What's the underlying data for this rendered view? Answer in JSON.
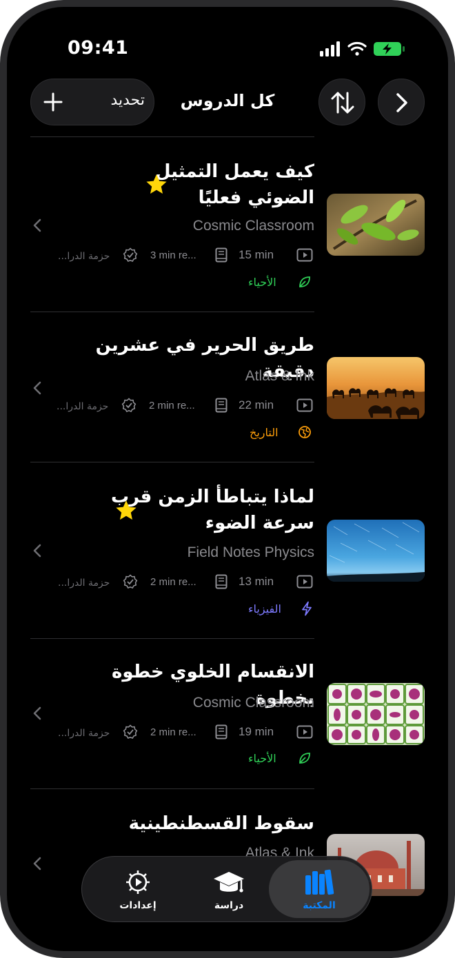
{
  "status_bar": {
    "time": "09:41"
  },
  "header": {
    "update_label": "تحديد",
    "title": "كل الدروس"
  },
  "lessons": [
    {
      "title_line1": "كيف يعمل التمثيل",
      "title_line2": "الضوئي فعليًا",
      "starred": true,
      "author": "Cosmic Classroom",
      "video_duration": "15 min",
      "reading_time": "3 min re...",
      "pack": "حزمة الدرا...",
      "subject": "الأحياء",
      "subject_color": "#30d158",
      "thumbnail": "leaves"
    },
    {
      "title_line1": "طريق الحرير في عشرين دقيقة",
      "starred": false,
      "author": "Atlas & Ink",
      "video_duration": "22 min",
      "reading_time": "2 min re...",
      "pack": "حزمة الدرا...",
      "subject": "التاريخ",
      "subject_color": "#ff9f0a",
      "thumbnail": "desert-camels"
    },
    {
      "title_line1": "لماذا يتباطأ الزمن قرب",
      "title_line2": "سرعة الضوء",
      "starred": true,
      "author": "Field Notes Physics",
      "video_duration": "13 min",
      "reading_time": "2 min re...",
      "pack": "حزمة الدرا...",
      "subject": "الفيزياء",
      "subject_color": "#7d7aff",
      "thumbnail": "star-trails"
    },
    {
      "title_line1": "الانقسام الخلوي خطوة بخطوة",
      "starred": false,
      "author": "Cosmic Classroom",
      "video_duration": "19 min",
      "reading_time": "2 min re...",
      "pack": "حزمة الدرا...",
      "subject": "الأحياء",
      "subject_color": "#30d158",
      "thumbnail": "cells"
    },
    {
      "title_line1": "سقوط القسطنطينية",
      "starred": false,
      "author": "Atlas & Ink",
      "thumbnail": "hagia-sophia"
    }
  ],
  "tab_bar": {
    "settings_label": "إعدادات",
    "study_label": "دراسة",
    "library_label": "المكتبة",
    "active_color": "#0a84ff"
  },
  "icons": {
    "plus": "plus-icon",
    "sort": "sort-arrows-icon",
    "next": "chevron-right-icon",
    "star": "star-icon",
    "video": "play-rectangle-icon",
    "book": "book-icon",
    "badge": "checkmark-seal-icon",
    "biology": "leaf-icon",
    "history": "globe-icon",
    "physics": "bolt-icon"
  }
}
